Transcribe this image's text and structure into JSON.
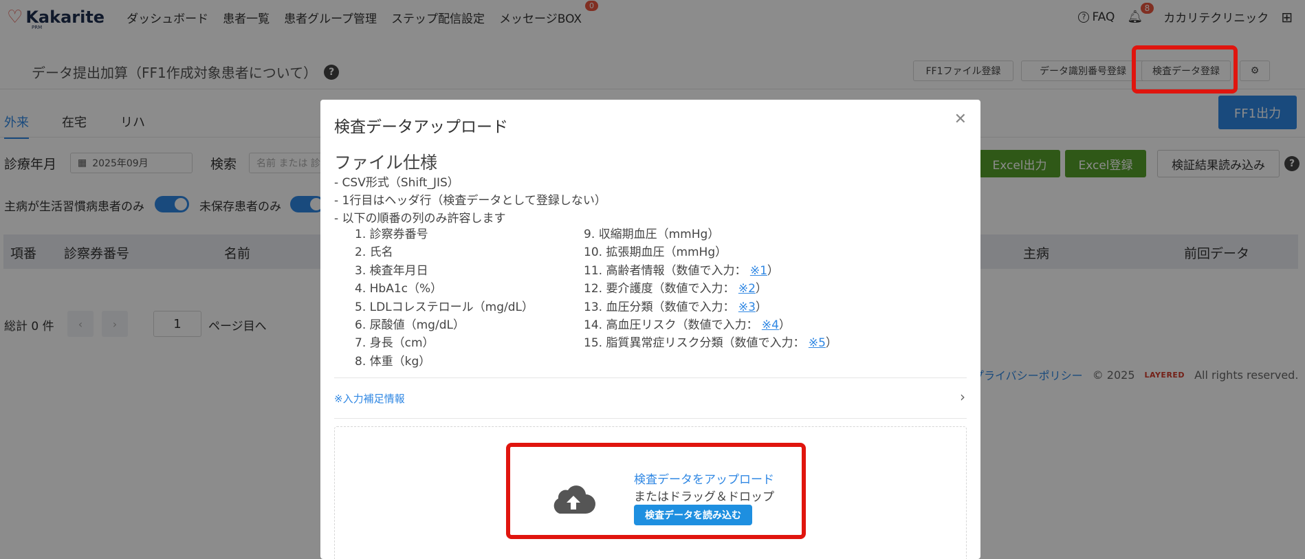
{
  "brand": {
    "name": "Kakarite",
    "sub": "PRM"
  },
  "nav": {
    "items": [
      "ダッシュボード",
      "患者一覧",
      "患者グループ管理",
      "ステップ配信設定",
      "メッセージBOX"
    ],
    "message_badge": "0",
    "faq": "FAQ",
    "notifications": "8",
    "clinic": "カカリテクリニック"
  },
  "subheader": {
    "title": "データ提出加算（FF1作成対象患者について）",
    "buttons": [
      "FF1ファイル登録",
      "データ識別番号登録",
      "検査データ登録"
    ]
  },
  "tabs": [
    "外来",
    "在宅",
    "リハ"
  ],
  "ff1_button": "FF1出力",
  "filters": {
    "month_label": "診療年月",
    "month_value": "2025年09月",
    "search_label": "検索",
    "search_placeholder": "名前 または 診",
    "excel_export": "Excel出力",
    "excel_import": "Excel登録",
    "verify_import": "検証結果読み込み"
  },
  "toggles": {
    "lifestyle": "主病が生活習慣病患者のみ",
    "unsaved": "未保存患者のみ"
  },
  "table": {
    "headers": [
      "項番",
      "診察券番号",
      "名前",
      "主病",
      "前回データ"
    ]
  },
  "pager": {
    "total": "総計 0 件",
    "page": "1",
    "goto": "ページ目へ"
  },
  "footer": {
    "privacy": "プライバシーポリシー",
    "copyright": "© 2025",
    "company": "LAYERED",
    "rights": "All rights reserved."
  },
  "modal": {
    "title": "検査データアップロード",
    "spec_title": "ファイル仕様",
    "spec_lines": [
      "- CSV形式（Shift_JIS）",
      "- 1行目はヘッダ行（検査データとして登録しない）",
      "- 以下の順番の列のみ許容します"
    ],
    "columns_left": [
      "1. 診察券番号",
      "2. 氏名",
      "3. 検査年月日",
      "4. HbA1c（%）",
      "5. LDLコレステロール（mg/dL）",
      "6. 尿酸値（mg/dL）",
      "7. 身長（cm）",
      "8. 体重（kg）"
    ],
    "columns_right": [
      {
        "text": "9. 収縮期血圧（mmHg）"
      },
      {
        "text": "10. 拡張期血圧（mmHg）"
      },
      {
        "text": "11. 高齢者情報（数値で入力：",
        "ref": "※1",
        "close": "）"
      },
      {
        "text": "12. 要介護度（数値で入力：",
        "ref": "※2",
        "close": "）"
      },
      {
        "text": "13. 血圧分類（数値で入力：",
        "ref": "※3",
        "close": "）"
      },
      {
        "text": "14. 高血圧リスク（数値で入力：",
        "ref": "※4",
        "close": "）"
      },
      {
        "text": "15. 脂質異常症リスク分類（数値で入力：",
        "ref": "※5",
        "close": "）"
      }
    ],
    "supplement": "※入力補足情報",
    "upload_link": "検査データをアップロード",
    "upload_or": "またはドラッグ＆ドロップ",
    "upload_button": "検査データを読み込む"
  },
  "colors": {
    "primary": "#2f87e3",
    "excel_green": "#56a02a",
    "highlight_red": "#e0150e",
    "badge_red": "#e9573f"
  }
}
